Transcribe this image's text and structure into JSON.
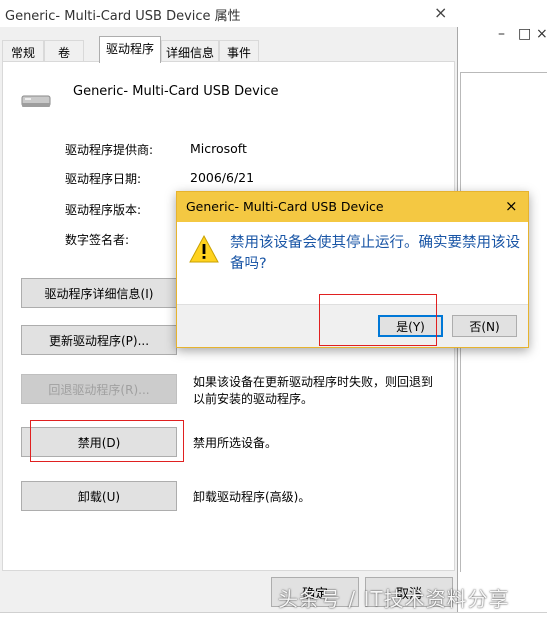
{
  "background_window": {
    "controls": [
      "–",
      "□",
      "×"
    ]
  },
  "properties_window": {
    "title": "Generic- Multi-Card USB Device 属性",
    "close_glyph": "×",
    "tabs": [
      {
        "label": "常规"
      },
      {
        "label": "卷"
      },
      {
        "label": "驱动程序"
      },
      {
        "label": "详细信息"
      },
      {
        "label": "事件"
      }
    ],
    "active_tab": "驱动程序",
    "device_name": "Generic- Multi-Card USB Device",
    "device_icon": "usb-card-reader-icon",
    "info": [
      {
        "label": "驱动程序提供商:",
        "value": "Microsoft"
      },
      {
        "label": "驱动程序日期:",
        "value": "2006/6/21"
      },
      {
        "label": "驱动程序版本:",
        "value": ""
      },
      {
        "label": "数字签名者:",
        "value": ""
      }
    ],
    "buttons": {
      "details": "驱动程序详细信息(I)",
      "update": "更新驱动程序(P)...",
      "rollback": "回退驱动程序(R)...",
      "disable": "禁用(D)",
      "uninstall": "卸载(U)"
    },
    "descriptions": {
      "rollback": "如果该设备在更新驱动程序时失败，则回退到以前安装的驱动程序。",
      "disable": "禁用所选设备。",
      "uninstall": "卸载驱动程序(高级)。"
    },
    "footer": {
      "ok": "确定",
      "cancel": "取消"
    }
  },
  "confirm_dialog": {
    "title": "Generic- Multi-Card USB Device",
    "close_glyph": "×",
    "icon": "warning-icon",
    "message": "禁用该设备会使其停止运行。确实要禁用该设备吗?",
    "yes": "是(Y)",
    "no": "否(N)"
  },
  "watermark": "头条号 / IT技术资料分享",
  "colors": {
    "dialog_title_bg": "#f4c842",
    "dialog_message": "#1a56a6",
    "highlight_box": "#e02020",
    "default_button_border": "#0078d7"
  }
}
